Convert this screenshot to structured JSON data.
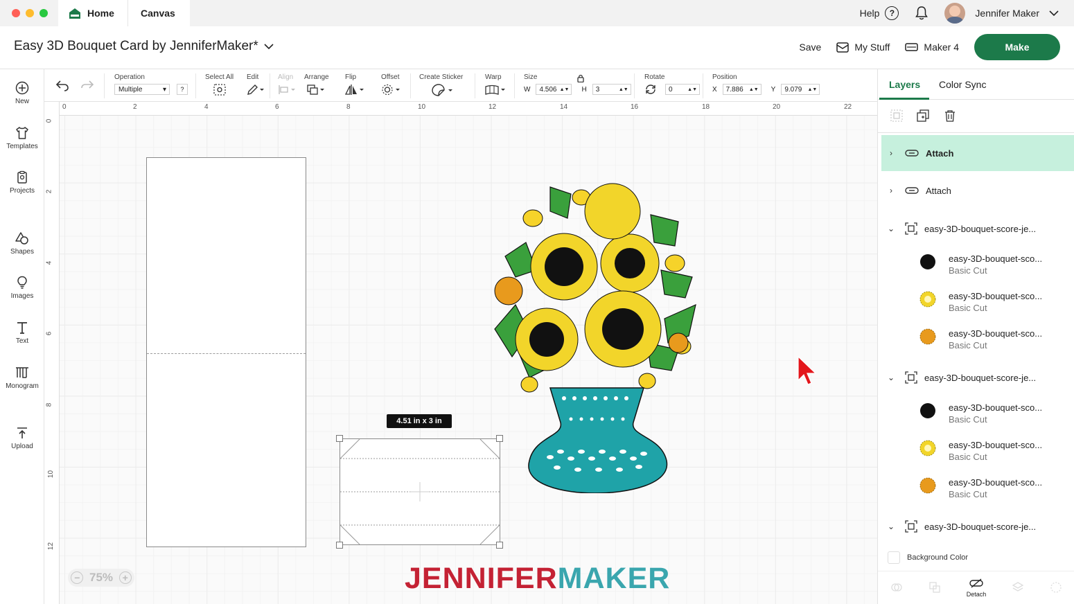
{
  "titlebar": {
    "tabs": [
      {
        "label": "Home"
      },
      {
        "label": "Canvas"
      }
    ],
    "help_label": "Help",
    "help_icon": "?",
    "user_name": "Jennifer Maker"
  },
  "project": {
    "title": "Easy 3D Bouquet Card by JenniferMaker*",
    "save_label": "Save",
    "my_stuff_label": "My Stuff",
    "machine_label": "Maker 4",
    "make_label": "Make"
  },
  "sidebar": {
    "items": [
      {
        "label": "New",
        "icon": "plus-circle-icon"
      },
      {
        "label": "Templates",
        "icon": "shirt-icon"
      },
      {
        "label": "Projects",
        "icon": "clipboard-icon"
      },
      {
        "label": "Shapes",
        "icon": "shapes-icon"
      },
      {
        "label": "Images",
        "icon": "bulb-icon"
      },
      {
        "label": "Text",
        "icon": "text-icon"
      },
      {
        "label": "Monogram",
        "icon": "monogram-icon"
      },
      {
        "label": "Upload",
        "icon": "upload-icon"
      }
    ]
  },
  "toolbar": {
    "operation_label": "Operation",
    "operation_value": "Multiple",
    "operation_help": "?",
    "select_all_label": "Select All",
    "edit_label": "Edit",
    "align_label": "Align",
    "arrange_label": "Arrange",
    "flip_label": "Flip",
    "offset_label": "Offset",
    "create_sticker_label": "Create Sticker",
    "warp_label": "Warp",
    "size_label": "Size",
    "w_label": "W",
    "w_value": "4.506",
    "h_label": "H",
    "h_value": "3",
    "rotate_label": "Rotate",
    "rotate_value": "0",
    "position_label": "Position",
    "x_label": "X",
    "x_value": "7.886",
    "y_label": "Y",
    "y_value": "9.079"
  },
  "canvas": {
    "ruler_top": [
      "0",
      "2",
      "4",
      "6",
      "8",
      "10",
      "12",
      "14",
      "16",
      "18",
      "20",
      "22"
    ],
    "ruler_left": [
      "0",
      "2",
      "4",
      "6",
      "8",
      "10",
      "12"
    ],
    "dimension_tag": "4.51  in x 3  in",
    "zoom_minus": "−",
    "zoom_value": "75%",
    "zoom_plus": "+",
    "watermark_a": "JENNIFER",
    "watermark_b": "MAKER"
  },
  "layers_panel": {
    "tabs": [
      {
        "label": "Layers"
      },
      {
        "label": "Color Sync"
      }
    ],
    "rows": [
      {
        "label": "Attach",
        "selected": true
      },
      {
        "label": "Attach",
        "selected": false
      },
      {
        "label": "easy-3D-bouquet-score-je..."
      }
    ],
    "group1_children": [
      {
        "name": "easy-3D-bouquet-sco...",
        "type": "Basic Cut",
        "color": "#111111"
      },
      {
        "name": "easy-3D-bouquet-sco...",
        "type": "Basic Cut",
        "color": "#f2d52a"
      },
      {
        "name": "easy-3D-bouquet-sco...",
        "type": "Basic Cut",
        "color": "#e89a1d"
      }
    ],
    "group2_label": "easy-3D-bouquet-score-je...",
    "group2_children": [
      {
        "name": "easy-3D-bouquet-sco...",
        "type": "Basic Cut",
        "color": "#111111"
      },
      {
        "name": "easy-3D-bouquet-sco...",
        "type": "Basic Cut",
        "color": "#f2d52a"
      },
      {
        "name": "easy-3D-bouquet-sco...",
        "type": "Basic Cut",
        "color": "#e89a1d"
      }
    ],
    "group3_label": "easy-3D-bouquet-score-je...",
    "background_color_label": "Background Color",
    "detach_label": "Detach"
  },
  "colors": {
    "brand_green": "#1c7a4a",
    "selected_row": "#c6f0dd",
    "vase_teal": "#1fa3a8",
    "watermark_red": "#c42234",
    "watermark_teal": "#3aa6ae"
  }
}
